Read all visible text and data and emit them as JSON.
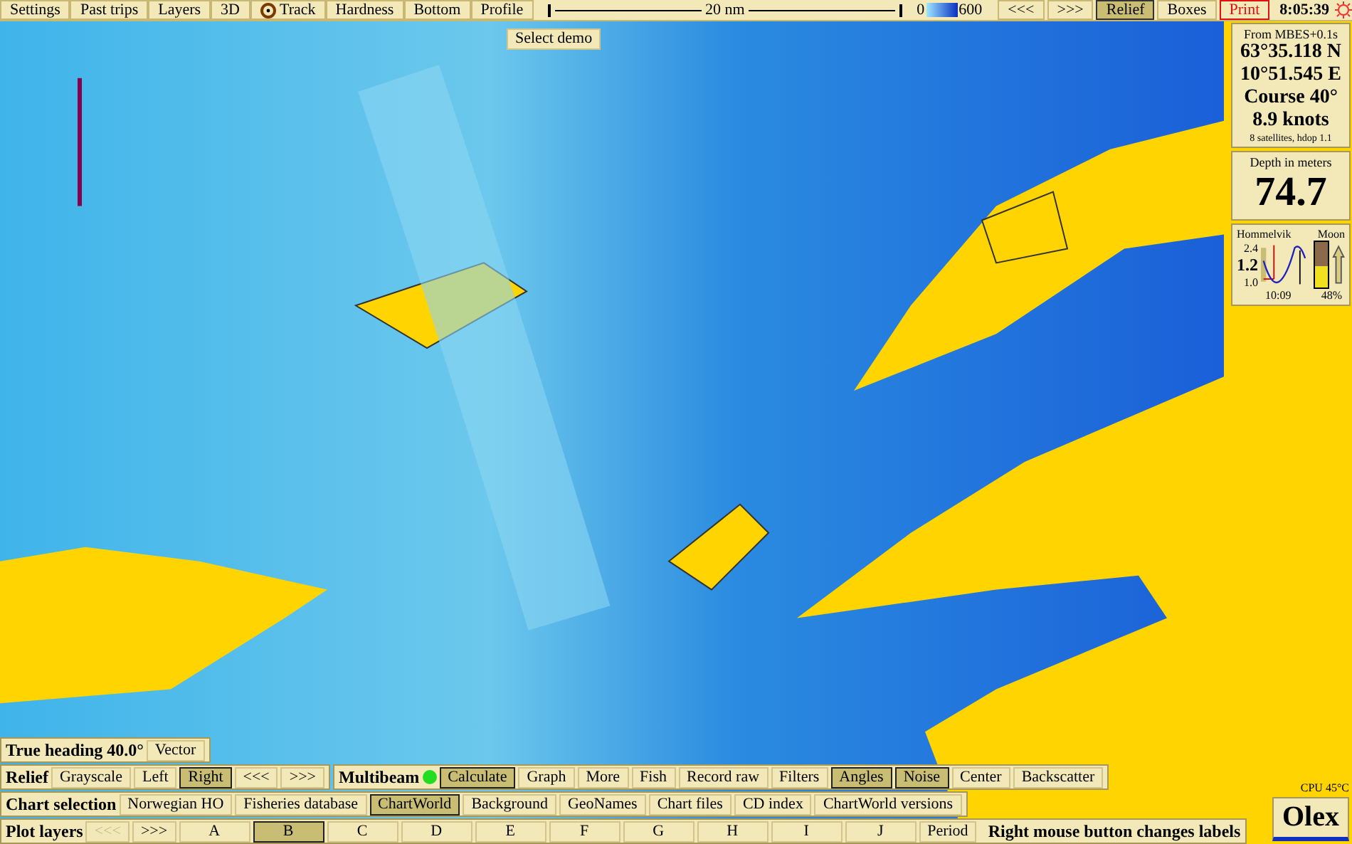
{
  "top_bar": {
    "buttons": [
      {
        "label": "Settings",
        "kind": "button"
      },
      {
        "label": "Past trips",
        "kind": "button"
      },
      {
        "label": "Layers",
        "kind": "button"
      },
      {
        "label": "3D",
        "kind": "button"
      },
      {
        "label": "Track",
        "kind": "target"
      },
      {
        "label": "Hardness",
        "kind": "button"
      },
      {
        "label": "Bottom",
        "kind": "button"
      },
      {
        "label": "Profile",
        "kind": "button"
      }
    ],
    "scale_label": "20 nm",
    "depth_min": "0",
    "depth_max": "600",
    "nav": [
      "<<<",
      ">>>"
    ],
    "toggles": [
      {
        "label": "Relief",
        "kind": "toggle",
        "selected": true
      },
      {
        "label": "Boxes",
        "kind": "toggle",
        "selected": false
      },
      {
        "label": "Print",
        "kind": "alert",
        "selected": false
      }
    ],
    "time": "8:05:39"
  },
  "select_demo": "Select demo",
  "position_panel": {
    "source": "From MBES+0.1s",
    "lat": "63°35.118 N",
    "lon": "10°51.545 E",
    "course": "Course 40°",
    "speed": "8.9 knots",
    "satellites": "8 satellites, hdop 1.1"
  },
  "depth_panel": {
    "label": "Depth in meters",
    "value": "74.7"
  },
  "tide_panel": {
    "place": "Hommelvik",
    "max": "2.4",
    "current": "1.2",
    "min": "1.0",
    "time": "10:09",
    "moon_label": "Moon",
    "moon_percent": "48%",
    "level": 0.48
  },
  "cpu": "CPU 45°C",
  "logo": "Olex",
  "heading_bar": {
    "title": "True heading 40.0°",
    "buttons": [
      {
        "label": "Vector",
        "selected": false
      }
    ]
  },
  "relief_bar": {
    "title": "Relief",
    "buttons": [
      {
        "label": "Grayscale",
        "selected": false
      },
      {
        "label": "Left",
        "selected": false
      },
      {
        "label": "Right",
        "selected": true
      },
      {
        "label": "<<<",
        "selected": false
      },
      {
        "label": ">>>",
        "selected": false
      }
    ]
  },
  "multibeam_bar": {
    "title": "Multibeam",
    "on": true,
    "buttons": [
      {
        "label": "Calculate",
        "selected": true
      },
      {
        "label": "Graph",
        "selected": false
      },
      {
        "label": "More",
        "selected": false
      },
      {
        "label": "Fish",
        "selected": false
      },
      {
        "label": "Record raw",
        "selected": false
      },
      {
        "label": "Filters",
        "selected": false
      },
      {
        "label": "Angles",
        "selected": true
      },
      {
        "label": "Noise",
        "selected": true
      },
      {
        "label": "Center",
        "selected": false
      },
      {
        "label": "Backscatter",
        "selected": false
      }
    ]
  },
  "chart_bar": {
    "title": "Chart selection",
    "buttons": [
      {
        "label": "Norwegian HO",
        "selected": false
      },
      {
        "label": "Fisheries database",
        "selected": false
      },
      {
        "label": "ChartWorld",
        "selected": true
      },
      {
        "label": "Background",
        "selected": false
      },
      {
        "label": "GeoNames",
        "selected": false
      },
      {
        "label": "Chart files",
        "selected": false
      },
      {
        "label": "CD index",
        "selected": false
      },
      {
        "label": "ChartWorld versions",
        "selected": false
      }
    ]
  },
  "plot_bar": {
    "title": "Plot layers",
    "buttons": [
      {
        "label": "<<<",
        "selected": false,
        "disabled": true
      },
      {
        "label": ">>>",
        "selected": false,
        "disabled": false
      },
      {
        "label": "A",
        "selected": false,
        "disabled": false
      },
      {
        "label": "B",
        "selected": true,
        "disabled": false
      },
      {
        "label": "C",
        "selected": false,
        "disabled": false
      },
      {
        "label": "D",
        "selected": false,
        "disabled": false
      },
      {
        "label": "E",
        "selected": false,
        "disabled": false
      },
      {
        "label": "F",
        "selected": false,
        "disabled": false
      },
      {
        "label": "G",
        "selected": false,
        "disabled": false
      },
      {
        "label": "H",
        "selected": false,
        "disabled": false
      },
      {
        "label": "I",
        "selected": false,
        "disabled": false
      },
      {
        "label": "J",
        "selected": false,
        "disabled": false
      },
      {
        "label": "Period",
        "selected": false,
        "disabled": false
      }
    ],
    "note": "Right mouse button changes labels"
  }
}
